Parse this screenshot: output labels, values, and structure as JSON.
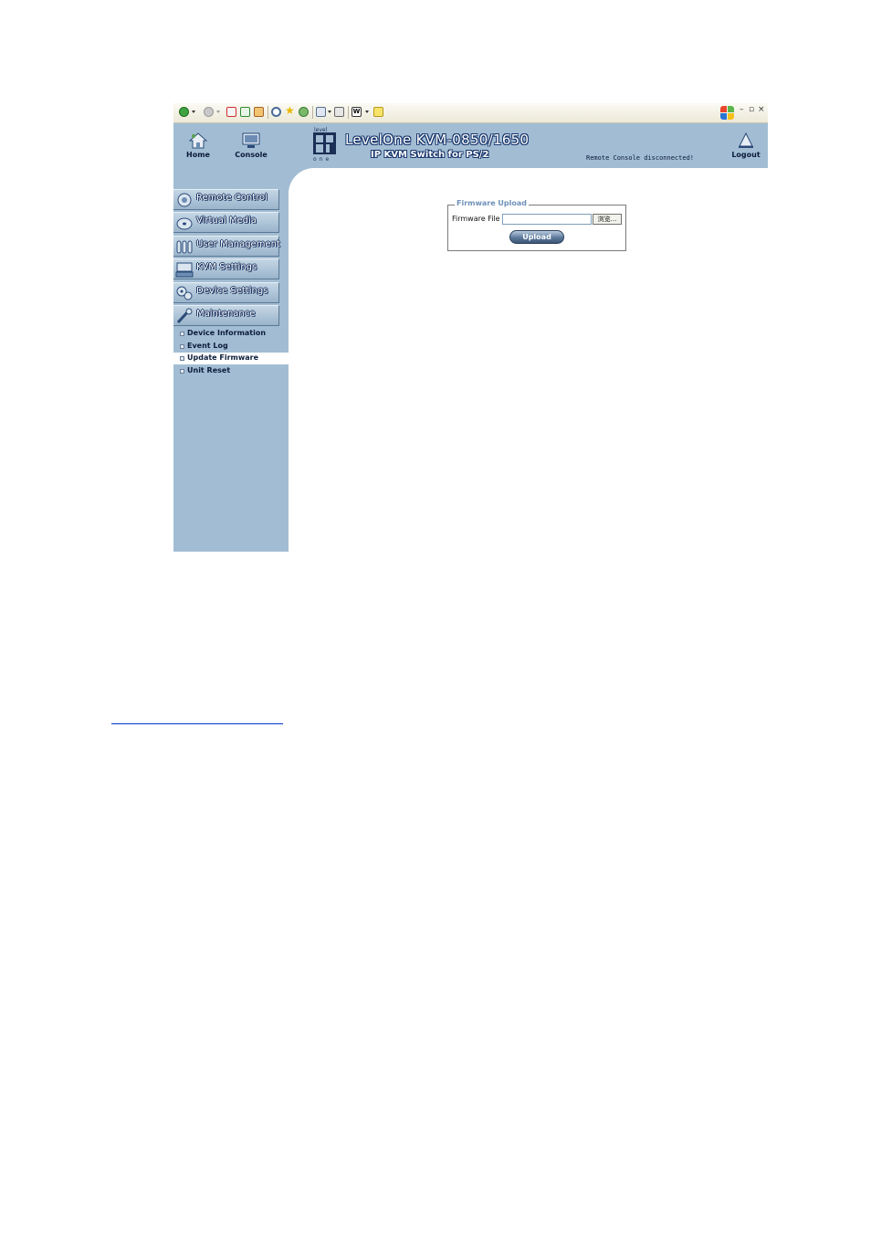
{
  "header": {
    "home_label": "Home",
    "console_label": "Console",
    "brand_logo_text": "level one",
    "brand_title": "LevelOne KVM-0850/1650",
    "brand_subtitle": "IP KVM Switch for PS/2",
    "status_message": "Remote Console disconnected!",
    "logout_label": "Logout"
  },
  "sidebar": {
    "menu": [
      {
        "label": "Remote Control",
        "icon": "remote-control-icon"
      },
      {
        "label": "Virtual Media",
        "icon": "disc-icon"
      },
      {
        "label": "User Management",
        "icon": "users-icon"
      },
      {
        "label": "KVM Settings",
        "icon": "kvm-icon"
      },
      {
        "label": "Device Settings",
        "icon": "gears-icon"
      },
      {
        "label": "Maintenance",
        "icon": "wrench-icon"
      }
    ],
    "submenu": [
      {
        "label": "Device Information",
        "active": false
      },
      {
        "label": "Event Log",
        "active": false
      },
      {
        "label": "Update Firmware",
        "active": true
      },
      {
        "label": "Unit Reset",
        "active": false
      }
    ]
  },
  "firmware_upload": {
    "legend": "Firmware Upload",
    "file_label": "Firmware File",
    "file_value": "",
    "browse_label": "浏览...",
    "upload_label": "Upload"
  },
  "colors": {
    "panel_blue": "#a2bdd3",
    "legend_blue": "#6f90b8",
    "link_blue": "#0033cc"
  }
}
